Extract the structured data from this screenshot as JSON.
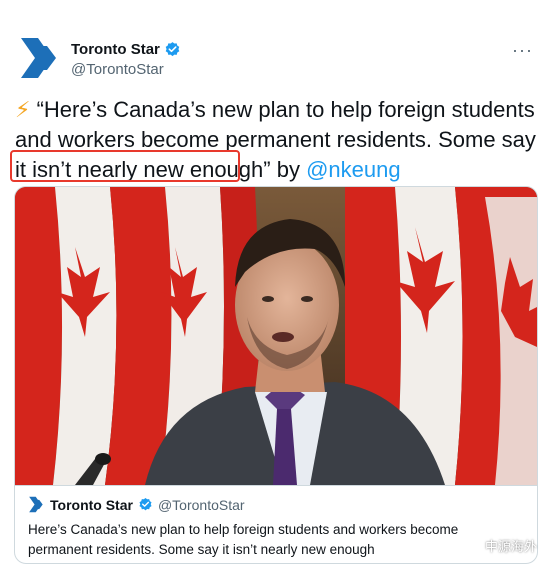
{
  "author": {
    "display_name": "Toronto Star",
    "handle": "@TorontoStar",
    "verified": true,
    "brand_color": "#1d6fb8"
  },
  "more_icon": "more-horizontal-icon",
  "tweet": {
    "emoji": "⚡",
    "quote": "“Here’s Canada’s new plan to help foreign students and workers become permanent residents. Some say it isn’t nearly new enough",
    "after_quote": "” by ",
    "mention": "@nkeung"
  },
  "card": {
    "author_name": "Toronto Star",
    "author_handle": "@TorontoStar",
    "text": "Here’s Canada’s new plan to help foreign students and workers become permanent residents. Some say it isn’t nearly new enough"
  },
  "watermark": {
    "label": "中源海外"
  },
  "colors": {
    "link": "#1d9bf0",
    "highlight": "#e8392d",
    "flag_red": "#d4251c"
  }
}
